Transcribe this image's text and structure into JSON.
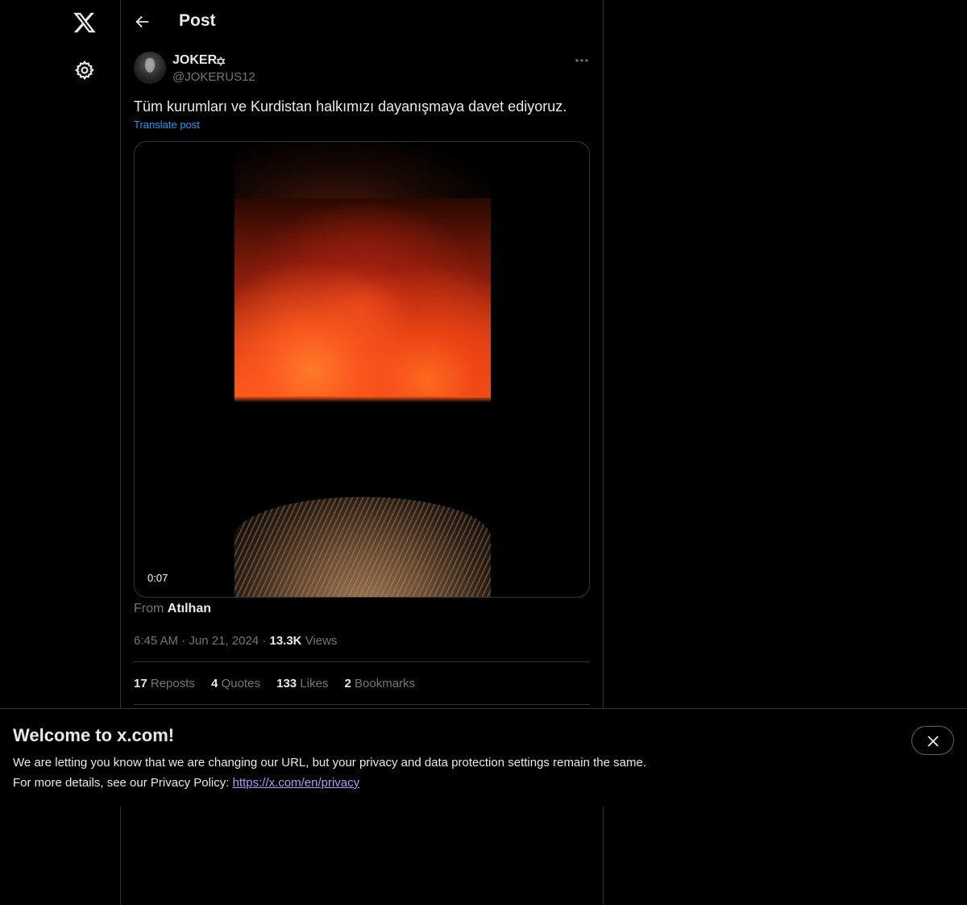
{
  "nav": {
    "logo_icon": "x-logo-icon",
    "settings_icon": "gear-icon"
  },
  "header": {
    "title": "Post",
    "back_icon": "arrow-left-icon"
  },
  "post": {
    "author": {
      "display_name": "JOKER",
      "handle": "@JOKERUS12",
      "badge_icon": "star-of-david-icon"
    },
    "text": "Tüm kurumları ve Kurdistan halkımızı dayanışmaya davet ediyoruz.",
    "translate_label": "Translate post",
    "media": {
      "duration": "0:07"
    },
    "from_prefix": "From",
    "from_name": "Atılhan",
    "time": "6:45 AM",
    "date": "Jun 21, 2024",
    "separator": "·",
    "views_count": "13.3K",
    "views_label": "Views",
    "stats": [
      {
        "num": "17",
        "label": "Reposts"
      },
      {
        "num": "4",
        "label": "Quotes"
      },
      {
        "num": "133",
        "label": "Likes"
      },
      {
        "num": "2",
        "label": "Bookmarks"
      }
    ]
  },
  "banner": {
    "title": "Welcome to x.com!",
    "line1": "We are letting you know that we are changing our URL, but your privacy and data protection settings remain the same.",
    "line2_prefix": "For more details, see our Privacy Policy: ",
    "link": "https://x.com/en/privacy",
    "close_icon": "close-icon"
  },
  "colors": {
    "background": "#000000",
    "text": "#e7e9ea",
    "muted": "#71767b",
    "accent": "#1d9bf0",
    "border": "#2f3336"
  }
}
